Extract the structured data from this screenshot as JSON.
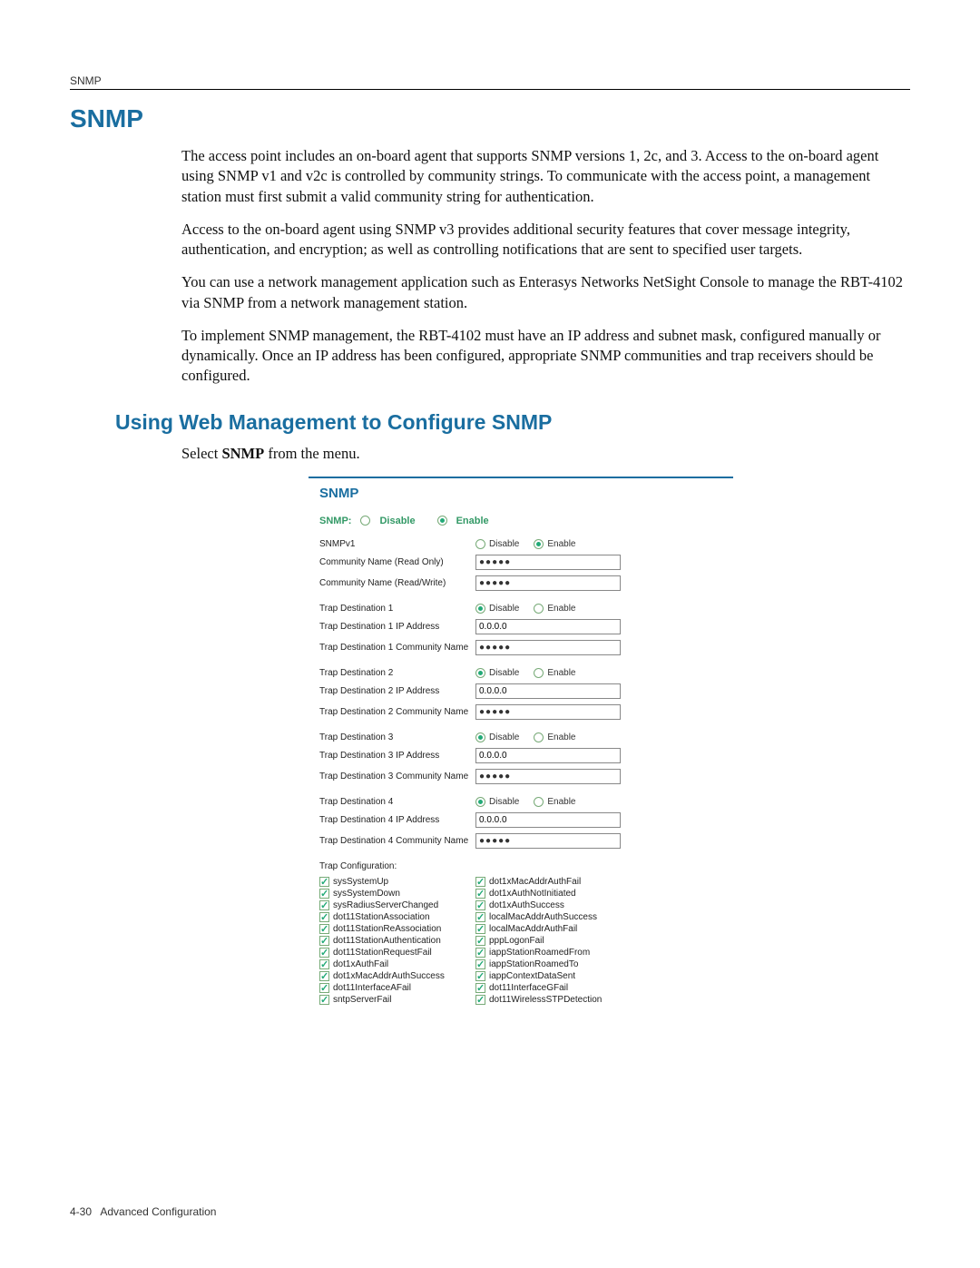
{
  "header": {
    "running": "SNMP"
  },
  "title": "SNMP",
  "paragraphs": {
    "p1": "The access point includes an on-board agent that supports SNMP versions 1, 2c, and 3. Access to the on-board agent using SNMP v1 and v2c is controlled by community strings. To communicate with the access point, a management station must first submit a valid community string for authentication.",
    "p2": "Access to the on-board agent using SNMP v3 provides additional security features that cover message integrity, authentication, and encryption; as well as controlling notifications that are sent to specified user targets.",
    "p3": "You can use a network management application such as Enterasys Networks NetSight Console to manage the RBT-4102 via SNMP from a network management station.",
    "p4": "To implement SNMP management, the RBT-4102 must have an IP address and subnet mask, configured manually or dynamically. Once an IP address has been configured, appropriate SNMP communities and trap receivers should be configured."
  },
  "subhead": "Using Web Management to Configure SNMP",
  "select_line_prefix": "Select ",
  "select_line_bold": "SNMP",
  "select_line_suffix": " from the menu.",
  "form": {
    "panel_title": "SNMP",
    "snmp_label": "SNMP:",
    "disable": "Disable",
    "enable": "Enable",
    "snmp_selected": "enable",
    "snmpv1_label": "SNMPv1",
    "snmpv1_selected": "enable",
    "community_ro_label": "Community Name (Read Only)",
    "community_rw_label": "Community Name (Read/Write)",
    "masked": "●●●●●",
    "trap_destinations": [
      {
        "label": "Trap Destination 1",
        "ip_label": "Trap Destination 1 IP Address",
        "ip": "0.0.0.0",
        "comm_label": "Trap Destination 1 Community Name",
        "selected": "disable"
      },
      {
        "label": "Trap Destination 2",
        "ip_label": "Trap Destination 2 IP Address",
        "ip": "0.0.0.0",
        "comm_label": "Trap Destination 2 Community Name",
        "selected": "disable"
      },
      {
        "label": "Trap Destination 3",
        "ip_label": "Trap Destination 3 IP Address",
        "ip": "0.0.0.0",
        "comm_label": "Trap Destination 3 Community Name",
        "selected": "disable"
      },
      {
        "label": "Trap Destination 4",
        "ip_label": "Trap Destination 4 IP Address",
        "ip": "0.0.0.0",
        "comm_label": "Trap Destination 4 Community Name",
        "selected": "disable"
      }
    ],
    "trap_config_label": "Trap Configuration:",
    "traps_left": [
      "sysSystemUp",
      "sysSystemDown",
      "sysRadiusServerChanged",
      "dot11StationAssociation",
      "dot11StationReAssociation",
      "dot11StationAuthentication",
      "dot11StationRequestFail",
      "dot1xAuthFail",
      "dot1xMacAddrAuthSuccess",
      "dot11InterfaceAFail",
      "sntpServerFail"
    ],
    "traps_right": [
      "dot1xMacAddrAuthFail",
      "dot1xAuthNotInitiated",
      "dot1xAuthSuccess",
      "localMacAddrAuthSuccess",
      "localMacAddrAuthFail",
      "pppLogonFail",
      "iappStationRoamedFrom",
      "iappStationRoamedTo",
      "iappContextDataSent",
      "dot11InterfaceGFail",
      "dot11WirelessSTPDetection"
    ]
  },
  "footer": {
    "page": "4-30",
    "label": "Advanced Configuration"
  }
}
